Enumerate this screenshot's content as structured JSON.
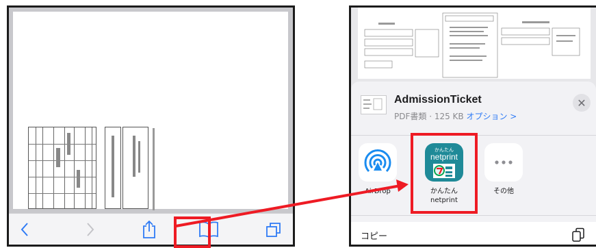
{
  "left_toolbar": {
    "buttons": [
      {
        "name": "back-button",
        "icon": "chevron-left-icon"
      },
      {
        "name": "forward-button",
        "icon": "chevron-right-icon"
      },
      {
        "name": "share-button",
        "icon": "share-icon"
      },
      {
        "name": "bookmarks-button",
        "icon": "book-icon"
      },
      {
        "name": "tabs-button",
        "icon": "tabs-icon"
      }
    ]
  },
  "share_sheet": {
    "file_name": "AdmissionTicket",
    "file_meta": "PDF書類 · 125 KB",
    "options_label": "オプション >",
    "close_label": "✕",
    "apps": [
      {
        "label": "AirDrop",
        "icon": "airdrop-icon"
      },
      {
        "label": "かんたん\nnetprint",
        "icon_title_small": "かんたん",
        "icon_title": "netprint",
        "icon": "netprint-icon"
      },
      {
        "label": "その他",
        "icon": "more-icon"
      }
    ],
    "copy_label": "コピー"
  },
  "colors": {
    "highlight": "#ee1b24",
    "accent_blue": "#2f7bf5",
    "netprint_teal": "#1f8a98"
  }
}
